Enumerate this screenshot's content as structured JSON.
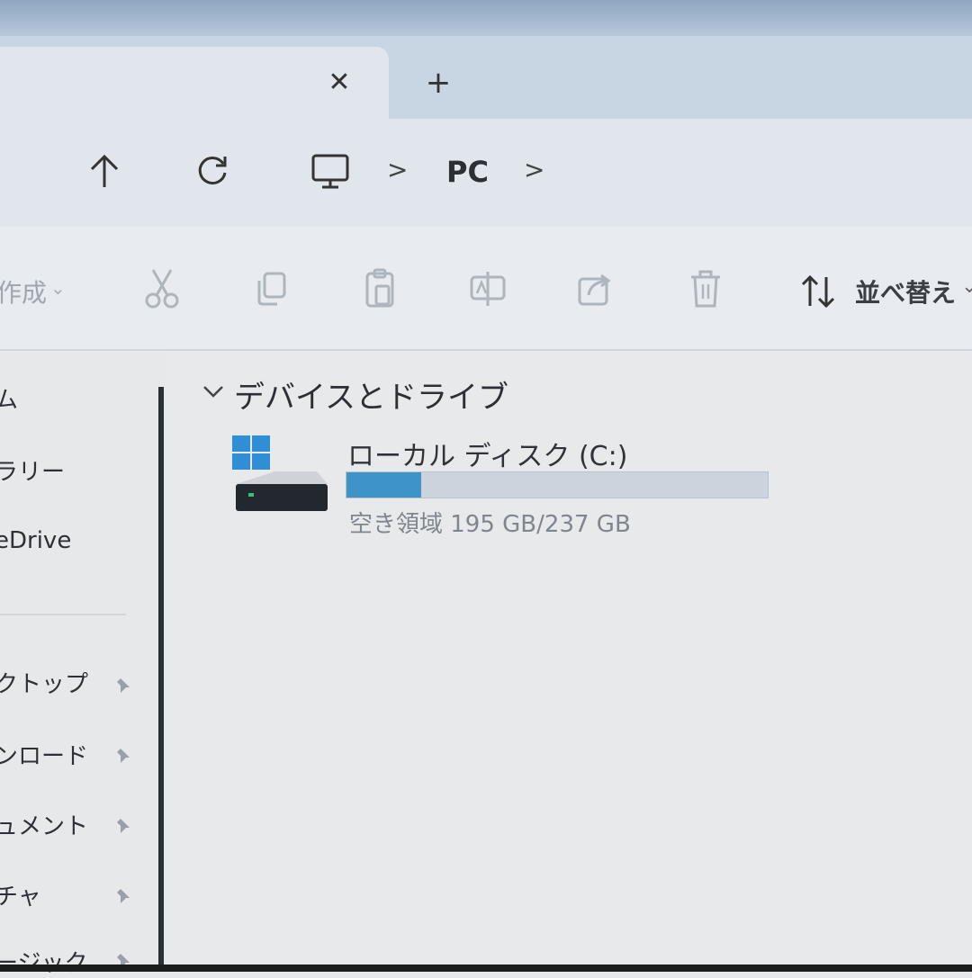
{
  "tab": {
    "close_glyph": "✕",
    "new_tab_glyph": "+"
  },
  "navigation": {
    "forward_glyph": "›",
    "breadcrumb": {
      "separator": ">",
      "location": "PC",
      "trailing": ">"
    }
  },
  "toolbar": {
    "new_label": "作成",
    "new_chevron": "⌄",
    "sort_label": "並べ替え",
    "sort_chevron": "⌄"
  },
  "sidebar": {
    "items": [
      {
        "label": "ム"
      },
      {
        "label": "ラリー"
      },
      {
        "label": "eDrive"
      },
      {
        "label": "クトップ"
      },
      {
        "label": "ンロード"
      },
      {
        "label": "ュメント"
      },
      {
        "label": "チャ"
      },
      {
        "label": "ージック"
      }
    ]
  },
  "main": {
    "section_title": "デバイスとドライブ",
    "drive": {
      "name": "ローカル ディスク (C:)",
      "free_text": "空き領域 195 GB/237 GB",
      "used_fraction": 0.177
    }
  },
  "colors": {
    "usage_bar_fill": "#3e93c7",
    "usage_bar_track": "#cdd3dc",
    "windows_logo": "#2f8ed4"
  },
  "icons": [
    "close-icon",
    "plus-icon",
    "forward-icon",
    "up-arrow-icon",
    "refresh-icon",
    "computer-icon",
    "cut-icon",
    "copy-icon",
    "paste-icon",
    "rename-icon",
    "share-icon",
    "delete-icon",
    "sort-icon",
    "pin-icon",
    "chevron-down-icon",
    "drive-icon"
  ]
}
